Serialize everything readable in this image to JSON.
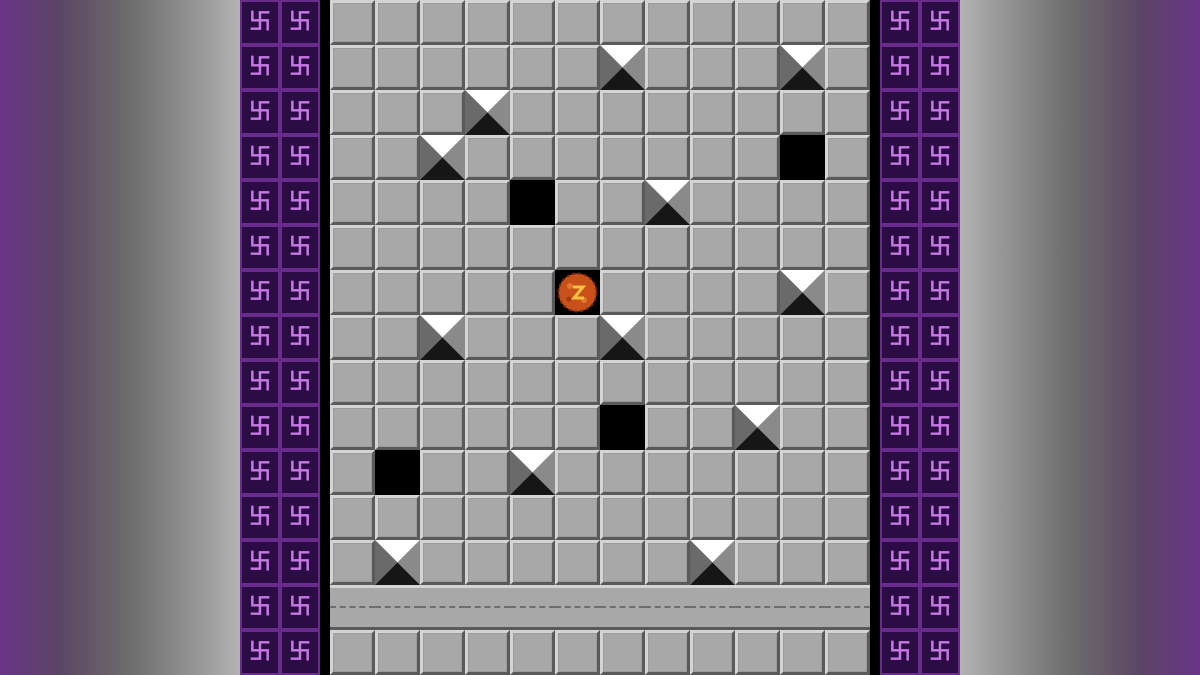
{
  "game": {
    "wall_glyph": "卐",
    "wall_rows": 15,
    "grid": [
      "TTTTTTTTTTTT",
      "TTTTTTSTTTST",
      "TTTSTTTTTTTT",
      "TTSTTTTTTTHT",
      "TTTTHTTSTTTT",
      "TTTTTTTTTTTT",
      "TTTTTPTTTTST",
      "TTSTTTSTTTTT",
      "TTTTTTTTTTTT",
      "TTTTTTHTTSTT",
      "THTTSTTTTTTT",
      "TTTTTTTTTTTT",
      "TSTTTTTTSTTT",
      "BBBBBBBBBBBB",
      "TTTTTTTTTTTT"
    ],
    "legend": {
      "T": "floor-tile",
      "S": "spike-trap",
      "H": "pit-hole",
      "P": "player-ball",
      "B": "conveyor-belt"
    },
    "colors": {
      "tile": "#a8a8a8",
      "wall": "#6a2c8c",
      "wall_glyph": "#c77ae6",
      "player": "#c8501a",
      "player_highlight": "#f4c040"
    }
  }
}
